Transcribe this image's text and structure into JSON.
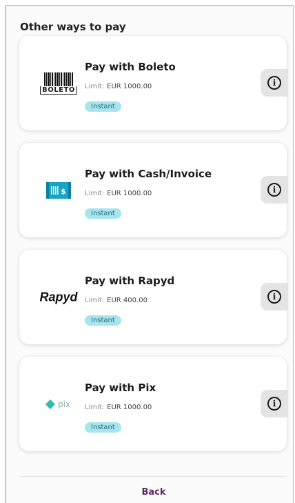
{
  "section_title": "Other ways to pay",
  "methods": [
    {
      "name": "Pay with Boleto",
      "limit_label": "Limit:",
      "limit_amount": "EUR 1000.00",
      "badge": "Instant",
      "logo_text": "BOLETO",
      "logo_icon": "barcode-icon"
    },
    {
      "name": "Pay with Cash/Invoice",
      "limit_label": "Limit:",
      "limit_amount": "EUR 1000.00",
      "badge": "Instant",
      "logo_text": "$",
      "logo_icon": "cash-invoice-icon"
    },
    {
      "name": "Pay with Rapyd",
      "limit_label": "Limit:",
      "limit_amount": "EUR 400.00",
      "badge": "Instant",
      "logo_text": "Rapyd",
      "logo_icon": "rapyd-logo"
    },
    {
      "name": "Pay with Pix",
      "limit_label": "Limit:",
      "limit_amount": "EUR 1000.00",
      "badge": "Instant",
      "logo_text": "pix",
      "logo_icon": "pix-logo"
    }
  ],
  "info_icon": "info-icon",
  "back_label": "Back",
  "colors": {
    "badge_bg": "#a6e5ed",
    "back_text": "#5b2a66",
    "pix_green": "#32bcad",
    "cash_teal": "#1aa3c3"
  }
}
